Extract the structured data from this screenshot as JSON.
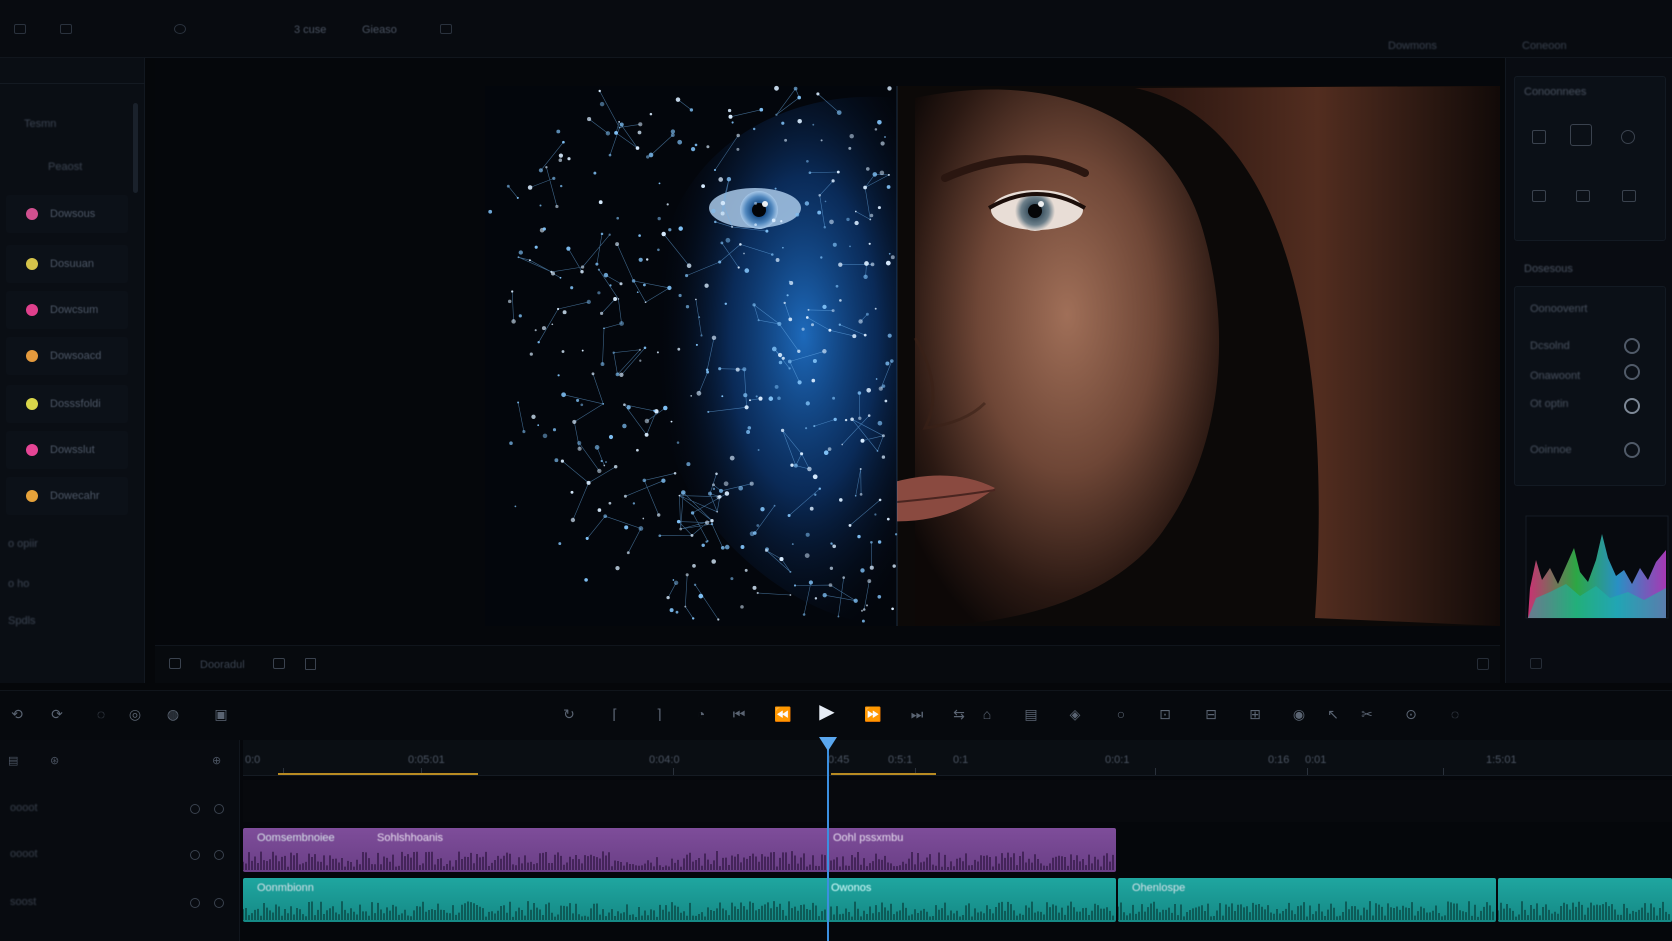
{
  "top_bar": {
    "breadcrumb": [
      "3 cuse",
      "Gieaso"
    ],
    "right_labels": [
      "Dowmons",
      "Coneoon"
    ]
  },
  "left_panel": {
    "items": [
      {
        "label": "Dowsous",
        "color": "#d0508f"
      },
      {
        "label": "Dosuuan",
        "color": "#d5c34a"
      },
      {
        "label": "Dowcsum",
        "color": "#e0408c"
      },
      {
        "label": "Dowsoacd",
        "color": "#e49a3d"
      },
      {
        "label": "Dosssfoldi",
        "color": "#d9d64a"
      },
      {
        "label": "Dowsslut",
        "color": "#e64595"
      },
      {
        "label": "Dowecahr",
        "color": "#e6a23a"
      }
    ],
    "misc": [
      "Tesmn",
      "Peaost",
      "o opiir",
      "o ho",
      "Spdls"
    ]
  },
  "viewer": {
    "footer_label": "Dooradul"
  },
  "right_panel": {
    "sections": [
      "Conoonnees",
      "Dosesous"
    ],
    "controls": [
      "Oonoovenrt",
      "Dcsolnd",
      "Onawoont",
      "Ot optin",
      "Ooinnoe"
    ]
  },
  "ruler": {
    "ticks": [
      "0:0",
      "0:05:01",
      "0:04:0",
      "0:45",
      "0:5:1",
      "0:1",
      "0:0:1",
      "0:16",
      "0:01",
      "1:5:01"
    ]
  },
  "timeline": {
    "track_labels": [
      "oooot",
      "oooot",
      "soost"
    ],
    "clips": {
      "violet_a": "Oomsembnoiee",
      "violet_b": "Sohlshhoanis",
      "violet_c": "Oohl pssxmbu",
      "teal_a": "Oonmbionn",
      "teal_b": "Owonos",
      "teal_c": "Ohenlospe"
    }
  },
  "colors": {
    "accent": "#3b8fe0",
    "violet_clip": "#7e4d9a",
    "teal_clip": "#1fa6a0",
    "range_marker": "#b78a22"
  }
}
